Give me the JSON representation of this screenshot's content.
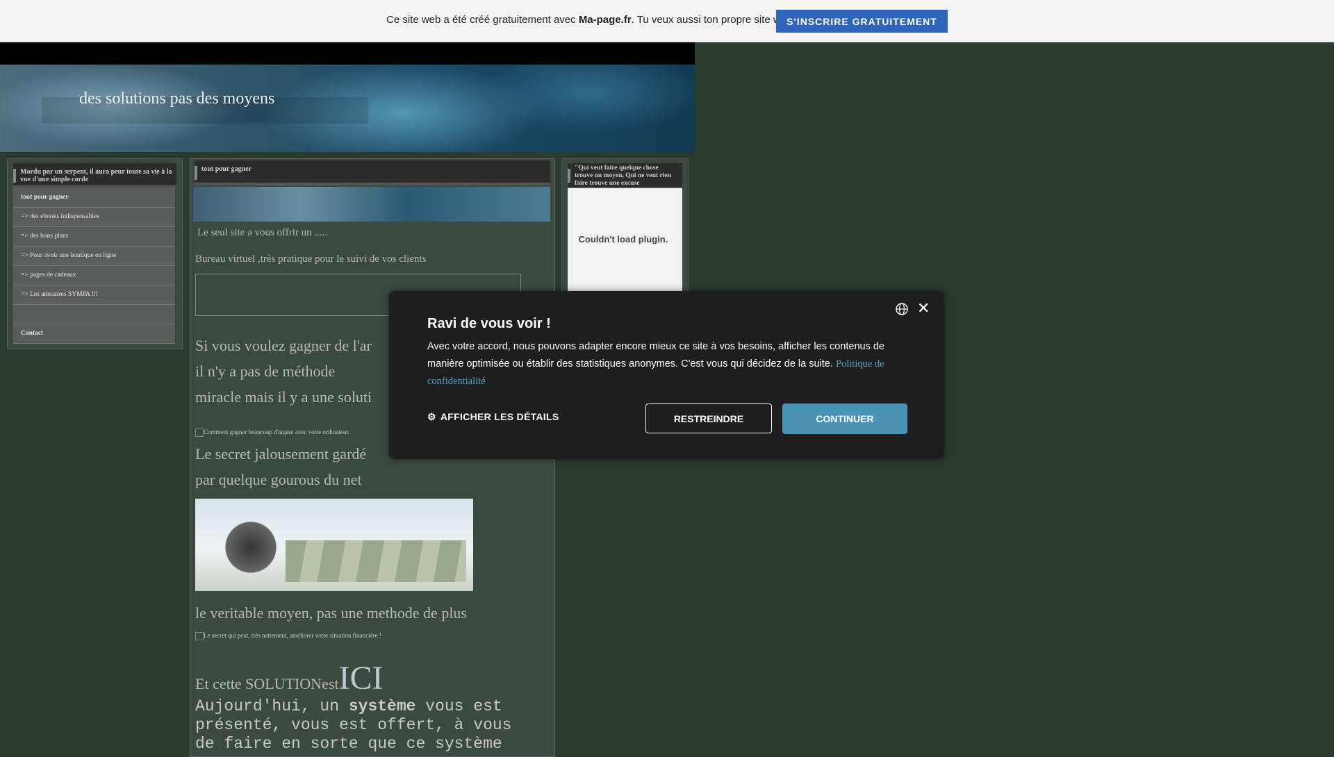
{
  "topbar": {
    "text_before": "Ce site web a été créé gratuitement avec ",
    "brand": "Ma-page.fr",
    "text_after": ". Tu veux aussi ton propre site web ?",
    "signup_label": "S'inscrire gratuitement"
  },
  "header": {
    "title": "des solutions pas des moyens"
  },
  "left_panel": {
    "heading": "Mordu par un serpent, il aura peur toute sa vie à la vue d'une simple corde",
    "items": [
      "tout pour gagner",
      "=> des ebooks indispensables",
      "=> des bons plans",
      "=> Pour avoir une boutique en ligne",
      "=> pages de cadeaux",
      "=> Les annuaires SYMPA !!!",
      "",
      "Contact"
    ]
  },
  "center_panel": {
    "heading": "tout pour gagner",
    "line1": "Le seul site a vous offrir un .....",
    "line2": "Bureau virtuel  ,très pratique pour le suivi de vos clients",
    "p1a": "Si vous voulez gagner de l'ar",
    "p1b": "il n'y a pas de méthode",
    "p1c": "miracle mais il y a une soluti",
    "img_alt1": "Comment gagner beaucoup d'argent avec votre ordinateur.",
    "p2a": "Le secret jalousement gardé",
    "p2b": "par quelque gourous du net",
    "p3": "le veritable moyen, pas une methode de plus",
    "img_alt2": "Le secret qui peut, très nettement, améliorer votre situation financière !",
    "p4": "Et cette SOLUTIONest",
    "p4_big": "ICI",
    "mono1a": "Aujourd'hui, un ",
    "mono1b": "système",
    "mono1c": " vous est",
    "mono2": "présenté, vous est offert, à vous",
    "mono3": "de faire en sorte que ce système"
  },
  "right_panel": {
    "heading": "\"Qui veut faire quelque chose trouve un moyen, Qui ne veut rien faire trouve une excuse",
    "plugin_text": "Couldn't load plugin."
  },
  "cookie": {
    "title": "Ravi de vous voir !",
    "body": "Avec votre accord, nous pouvons adapter encore mieux ce site à vos besoins, afficher les contenus de manière optimisée ou établir des statistiques anonymes. C'est vous qui décidez de la suite. ",
    "privacy_link": "Politique de confidentialité",
    "details_label": "AFFICHER LES DÉTAILS",
    "restrict_label": "RESTREINDRE",
    "continue_label": "CONTINUER"
  }
}
